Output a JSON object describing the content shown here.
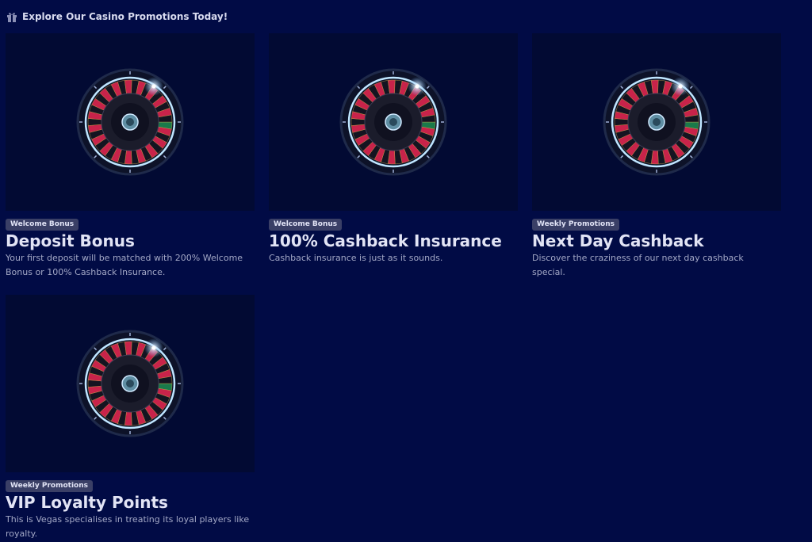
{
  "header": {
    "title": "Explore Our Casino Promotions Today!",
    "icon": "gift-icon"
  },
  "colors": {
    "background": "#010b45",
    "card_image_bg": "#020a33",
    "badge_bg": "#3a3f66",
    "wheel_red": "#c8234a",
    "wheel_ring": "#bfe6ff"
  },
  "promotions": [
    {
      "badge": "Welcome Bonus",
      "title": "Deposit Bonus",
      "description": "Your first deposit will be matched with 200% Welcome Bonus or 100% Cashback Insurance.",
      "image": "roulette-wheel"
    },
    {
      "badge": "Welcome Bonus",
      "title": "100% Cashback Insurance",
      "description": "Cashback insurance is just as it sounds.",
      "image": "roulette-wheel"
    },
    {
      "badge": "Weekly Promotions",
      "title": "Next Day Cashback",
      "description": "Discover the craziness of our next day cashback special.",
      "image": "roulette-wheel"
    },
    {
      "badge": "Weekly Promotions",
      "title": "VIP Loyalty Points",
      "description": "This is Vegas specialises in treating its loyal players like royalty.",
      "image": "roulette-wheel"
    }
  ]
}
